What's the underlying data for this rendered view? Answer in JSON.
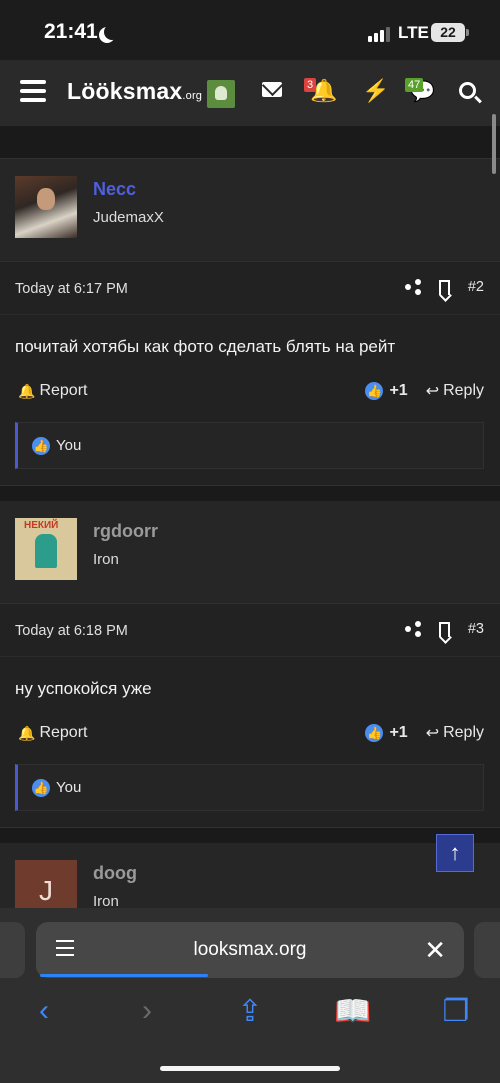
{
  "status": {
    "time": "21:41",
    "network": "LTE",
    "battery": "22"
  },
  "nav": {
    "logo_text": "Lööksmax",
    "logo_suffix": ".org",
    "alerts_count": "3",
    "conversations_count": "47"
  },
  "posts": [
    {
      "username": "Necc",
      "username_color": "#4f5fe0",
      "user_title": "JudemaxX",
      "time": "Today at 6:17 PM",
      "number": "#2",
      "text": "почитай хотябы как фото сделать блять на рейт",
      "report_label": "Report",
      "like_count": "+1",
      "reply_label": "Reply",
      "reaction_by": "You"
    },
    {
      "username": "rgdoorr",
      "username_color": "#9a9a9a",
      "user_title": "Iron",
      "time": "Today at 6:18 PM",
      "number": "#3",
      "text": "ну успокойся уже",
      "report_label": "Report",
      "like_count": "+1",
      "reply_label": "Reply",
      "reaction_by": "You"
    },
    {
      "username": "doog",
      "username_color": "#9a9a9a",
      "user_title": "Iron",
      "avatar_letter": "J"
    }
  ],
  "browser": {
    "url": "looksmax.org"
  },
  "icons": {
    "menu": "hamburger-icon",
    "mail": "mail-icon",
    "alerts": "bell-icon",
    "whats_new": "bolt-icon",
    "conversations": "chat-icon",
    "search": "search-icon"
  }
}
